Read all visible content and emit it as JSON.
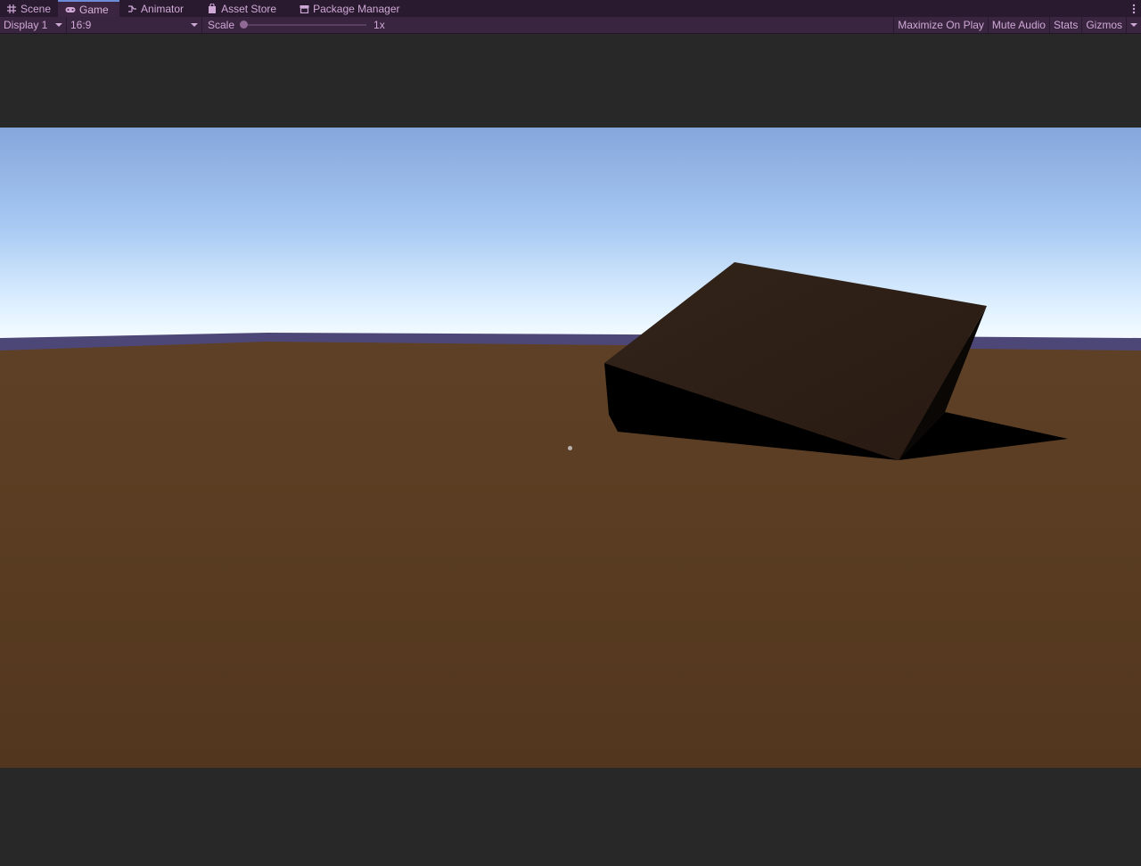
{
  "tabs": [
    {
      "label": "Scene",
      "icon": "grid-icon",
      "active": false
    },
    {
      "label": "Game",
      "icon": "gamepad-icon",
      "active": true
    },
    {
      "label": "Animator",
      "icon": "animator-icon",
      "active": false
    },
    {
      "label": "Asset Store",
      "icon": "shopping-bag-icon",
      "active": false
    },
    {
      "label": "Package Manager",
      "icon": "package-icon",
      "active": false
    }
  ],
  "toolbar": {
    "display_label": "Display 1",
    "aspect_label": "16:9",
    "scale_label": "Scale",
    "scale_value": "1x",
    "scale_fraction": 0,
    "maximize_label": "Maximize On Play",
    "mute_label": "Mute Audio",
    "stats_label": "Stats",
    "gizmos_label": "Gizmos"
  },
  "colors": {
    "accent": "#6d8cd8",
    "tab_text": "#cfa8d6",
    "sky_top": "#87aadc",
    "horizon": "#f2fbff",
    "ground": "#5a3d22",
    "box_top": "#2e1f16",
    "shadow": "#000000"
  }
}
